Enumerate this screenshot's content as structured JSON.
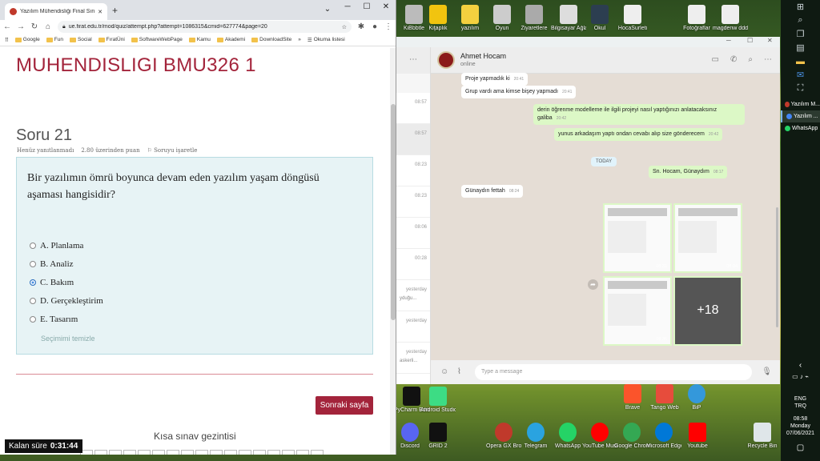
{
  "desktop": {
    "top_icons": [
      "Ki̇Bbbtle",
      "Ki̇ţȧplık",
      "yazılım",
      "Oyun",
      "Ziyaretlere",
      "Bilgisayar Ağları...",
      "Okul",
      "HocaSurleti",
      "",
      "",
      "",
      "",
      "",
      "",
      "",
      "",
      "",
      "Fotoğraflar",
      "magdenw dddddd"
    ],
    "bottom_row1": [
      "PyCharm Edition 2021...",
      "Android Studio",
      "",
      "",
      "",
      "",
      "",
      "Brave",
      "Tango Web",
      "BiP"
    ],
    "bottom_row2": [
      "Discord",
      "GRID 2",
      "",
      "Opera GX Browser",
      "Telegram",
      "WhatsApp",
      "YouTube Music",
      "Google Chrome",
      "Microsoft Edge",
      "Youtube",
      "",
      "",
      "Recycle Bin"
    ]
  },
  "taskbar": {
    "apps": [
      {
        "label": "Yazılım M...",
        "color": "#c0392b"
      },
      {
        "label": "Yazılım ...",
        "color": "#4285f4"
      },
      {
        "label": "WhatsApp",
        "color": "#25d366"
      }
    ],
    "lang": "ENG",
    "lang2": "TRQ",
    "time": "08:58",
    "day": "Monday",
    "date": "07/06/2021"
  },
  "browser": {
    "tab_title": "Yazılım Mühendisliği Final Sınavı",
    "new_tab": "+",
    "url": "ue.firat.edu.tr/mod/quiz/attempt.php?attempt=1086315&cmid=627774&page=20",
    "bookmarks": [
      "Google",
      "Fun",
      "Social",
      "FıratÜni",
      "SoftwareWebPage",
      "Kamu",
      "Akademi",
      "DownloadSite"
    ],
    "reading_list": "Okuma listesi",
    "more": "»"
  },
  "quiz": {
    "course_title": "MUHENDISLIGI BMU326 1",
    "question_no": "Soru 21",
    "status": "Henüz yanıtlanmadı",
    "points": "2.80 üzerinden puan",
    "flag": "Soruyu işaretle",
    "question": "Bir yazılımın ömrü boyunca devam eden yazılım yaşam döngüsü aşaması hangisidir?",
    "options": [
      {
        "label": "A. Planlama",
        "selected": false
      },
      {
        "label": "B. Analiz",
        "selected": false
      },
      {
        "label": "C. Bakım",
        "selected": true
      },
      {
        "label": "D. Gerçekleştirim",
        "selected": false
      },
      {
        "label": "E. Tasarım",
        "selected": false
      }
    ],
    "clear": "Seçimimi temizle",
    "next": "Sonraki sayfa",
    "nav_title": "Kısa sınav gezintisi",
    "timer_label": "Kalan süre",
    "timer_value": "0:31:44"
  },
  "whatsapp": {
    "contact": "Ahmet Hocam",
    "status": "online",
    "chat_times": [
      "08:57",
      "08:57",
      "08:23",
      "08:23",
      "08:06",
      "00:28",
      "yesterday",
      "yesterday",
      "yesterday"
    ],
    "chat_snippets": [
      "",
      "",
      "",
      "",
      "",
      "",
      "yduğu...",
      "",
      "askerli..."
    ],
    "messages": [
      {
        "text": "Proje yapmadık ki",
        "time": "20:41",
        "dir": "in"
      },
      {
        "text": "Grup vardı ama kimse bişey yapmadı",
        "time": "20:41",
        "dir": "in"
      },
      {
        "text": "derin öğrenme modelleme ile ilgili projeyi nasıl yaptığınızı anlatacaksınız galiba",
        "time": "20:42",
        "dir": "out"
      },
      {
        "text": "yunus arkadaşım yaptı ondan cevabı alıp size gönderecem",
        "time": "20:42",
        "dir": "out"
      },
      {
        "text": "Sn. Hocam, Günaydım",
        "time": "08:17",
        "dir": "out"
      },
      {
        "text": "Günaydın fettah",
        "time": "08:24",
        "dir": "in"
      }
    ],
    "day_label": "TODAY",
    "image_times": [
      "08:31",
      "08:34",
      "08:36"
    ],
    "more_count": "+18",
    "compose_placeholder": "Type a message"
  }
}
